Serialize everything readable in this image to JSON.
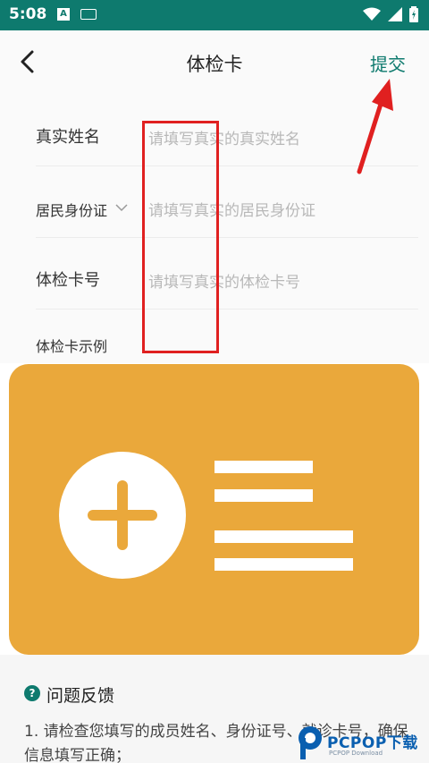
{
  "status_bar": {
    "time": "5:08",
    "notif_letter": "A"
  },
  "header": {
    "title": "体检卡",
    "submit_label": "提交"
  },
  "form": {
    "rows": [
      {
        "label": "真实姓名",
        "placeholder": "请填写真实的真实姓名"
      },
      {
        "label": "居民身份证",
        "placeholder": "请填写真实的居民身份证"
      },
      {
        "label": "体检卡号",
        "placeholder": "请填写真实的体检卡号"
      }
    ],
    "example_label": "体检卡示例"
  },
  "feedback": {
    "title": "问题反馈",
    "text": "1. 请检查您填写的成员姓名、身份证号、就诊卡号，确保信息填写正确；"
  },
  "watermark": {
    "brand": "PCPOP下载",
    "sub": "PCPOP Download"
  },
  "colors": {
    "accent": "#0e7a6e",
    "card": "#eaa83b",
    "annotation": "#e02020"
  }
}
